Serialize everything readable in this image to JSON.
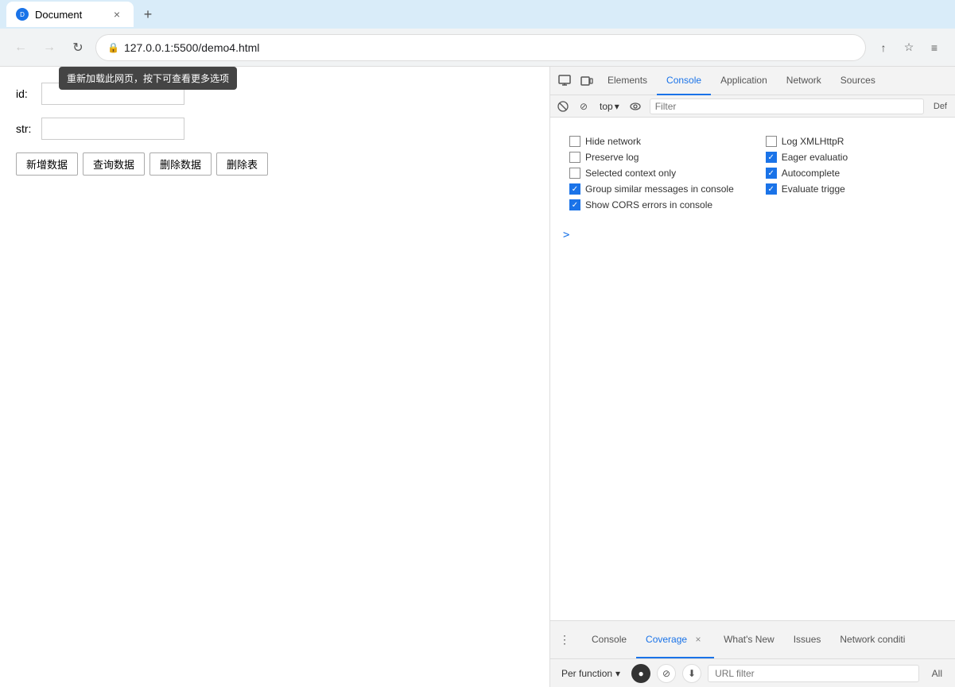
{
  "browser": {
    "tab": {
      "favicon": "D",
      "title": "Document",
      "close_icon": "×"
    },
    "new_tab_icon": "+",
    "address": {
      "lock_icon": "🔒",
      "url": "127.0.0.1:5500/demo4.html",
      "back_icon": "←",
      "forward_icon": "→",
      "reload_icon": "↻",
      "tooltip": "重新加载此网页，按下可查看更多选项",
      "share_icon": "↑",
      "bookmark_icon": "☆",
      "menu_icon": "≡"
    }
  },
  "webpage": {
    "id_label": "id:",
    "str_label": "str:",
    "id_placeholder": "",
    "str_placeholder": "",
    "buttons": [
      "新增数据",
      "查询数据",
      "删除数据",
      "删除表"
    ]
  },
  "devtools": {
    "top_tabs": [
      {
        "label": "Elements",
        "active": false
      },
      {
        "label": "Console",
        "active": true
      },
      {
        "label": "Application",
        "active": false
      },
      {
        "label": "Network",
        "active": false
      },
      {
        "label": "Sources",
        "active": false
      }
    ],
    "icons": {
      "inspect_icon": "⬚",
      "device_icon": "▭"
    },
    "console_toolbar": {
      "stop_icon": "⊘",
      "filter_placeholder": "Filter",
      "top_label": "top",
      "dropdown_arrow": "▾",
      "eye_icon": "👁",
      "def_label": "Def"
    },
    "settings": {
      "left_column": [
        {
          "label": "Hide network",
          "checked": false
        },
        {
          "label": "Preserve log",
          "checked": false
        },
        {
          "label": "Selected context only",
          "checked": false
        },
        {
          "label": "Group similar messages in console",
          "checked": true
        },
        {
          "label": "Show CORS errors in console",
          "checked": true
        }
      ],
      "right_column": [
        {
          "label": "Log XMLHttpR",
          "checked": false
        },
        {
          "label": "Eager evaluatio",
          "checked": true
        },
        {
          "label": "Autocomplete",
          "checked": true
        },
        {
          "label": "Evaluate trigge",
          "checked": true
        }
      ]
    },
    "prompt_arrow": ">",
    "bottom_drawer": {
      "menu_icon": "⋮",
      "tabs": [
        {
          "label": "Console",
          "active": false,
          "closeable": false
        },
        {
          "label": "Coverage",
          "active": true,
          "closeable": true
        },
        {
          "label": "What's New",
          "active": false,
          "closeable": false
        },
        {
          "label": "Issues",
          "active": false,
          "closeable": false
        },
        {
          "label": "Network conditi",
          "active": false,
          "closeable": false
        }
      ]
    },
    "coverage_bar": {
      "per_function_label": "Per function",
      "dropdown_arrow": "▾",
      "record_icon": "●",
      "stop_icon": "⊘",
      "download_icon": "⬇",
      "url_placeholder": "URL filter",
      "all_label": "All"
    }
  }
}
